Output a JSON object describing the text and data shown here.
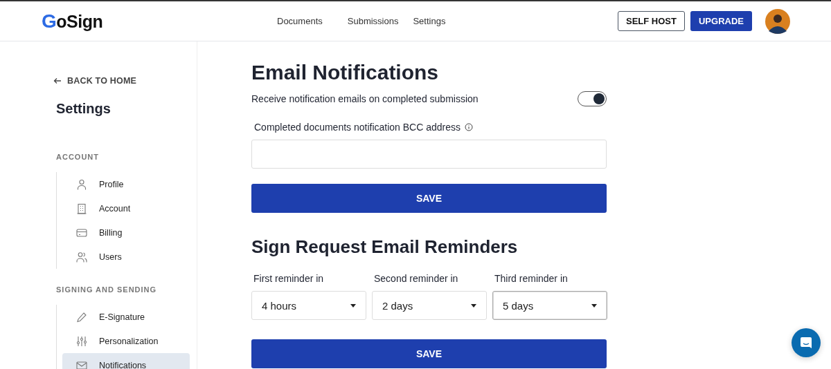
{
  "logo": {
    "mark": "G",
    "text": "oSign"
  },
  "nav": [
    {
      "label": "Documents"
    },
    {
      "label": "Submissions"
    },
    {
      "label": "Settings"
    }
  ],
  "header_buttons": {
    "self_host": "SELF HOST",
    "upgrade": "UPGRADE"
  },
  "sidebar": {
    "back": "BACK TO HOME",
    "title": "Settings",
    "sections": [
      {
        "heading": "ACCOUNT",
        "items": [
          {
            "label": "Profile",
            "kind": "user",
            "selected": false
          },
          {
            "label": "Account",
            "kind": "building",
            "selected": false
          },
          {
            "label": "Billing",
            "kind": "card",
            "selected": false
          },
          {
            "label": "Users",
            "kind": "users",
            "selected": false
          }
        ]
      },
      {
        "heading": "SIGNING AND SENDING",
        "items": [
          {
            "label": "E-Signature",
            "kind": "pen",
            "selected": false
          },
          {
            "label": "Personalization",
            "kind": "sliders",
            "selected": false
          },
          {
            "label": "Notifications",
            "kind": "mail",
            "selected": true
          }
        ]
      }
    ]
  },
  "email_notifications": {
    "title": "Email Notifications",
    "toggle_label": "Receive notification emails on completed submission",
    "toggle_on": true,
    "bcc_label": "Completed documents notification BCC address",
    "save": "SAVE"
  },
  "reminders": {
    "title": "Sign Request Email Reminders",
    "fields": [
      {
        "label": "First reminder in",
        "value": "4 hours",
        "focused": false
      },
      {
        "label": "Second reminder in",
        "value": "2 days",
        "focused": false
      },
      {
        "label": "Third reminder in",
        "value": "5 days",
        "focused": true
      }
    ],
    "save": "SAVE"
  }
}
